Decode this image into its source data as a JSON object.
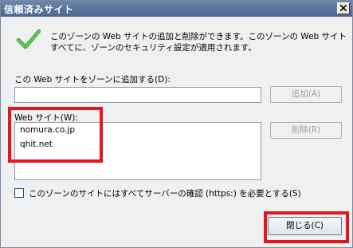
{
  "window": {
    "title": "信頼済みサイト",
    "accent_color": "#57739a"
  },
  "info": {
    "text": "このゾーンの Web サイトの追加と削除ができます。このゾーンの Web サイトすべてに、ゾーンのセキュリティ設定が適用されます。"
  },
  "add_site": {
    "label": "この Web サイトをゾーンに追加する(D):",
    "input_value": "",
    "add_button_label": "追加(A)"
  },
  "sites": {
    "label": "Web サイト(W):",
    "items": [
      "nomura.co.jp",
      "qhit.net"
    ],
    "remove_button_label": "削除(R)"
  },
  "https_option": {
    "label": "このゾーンのサイトにはすべてサーバーの確認 (https:) を必要とする(S)",
    "checked": false
  },
  "footer": {
    "close_button_label": "閉じる(C)"
  },
  "highlight_color": "#e8141d"
}
